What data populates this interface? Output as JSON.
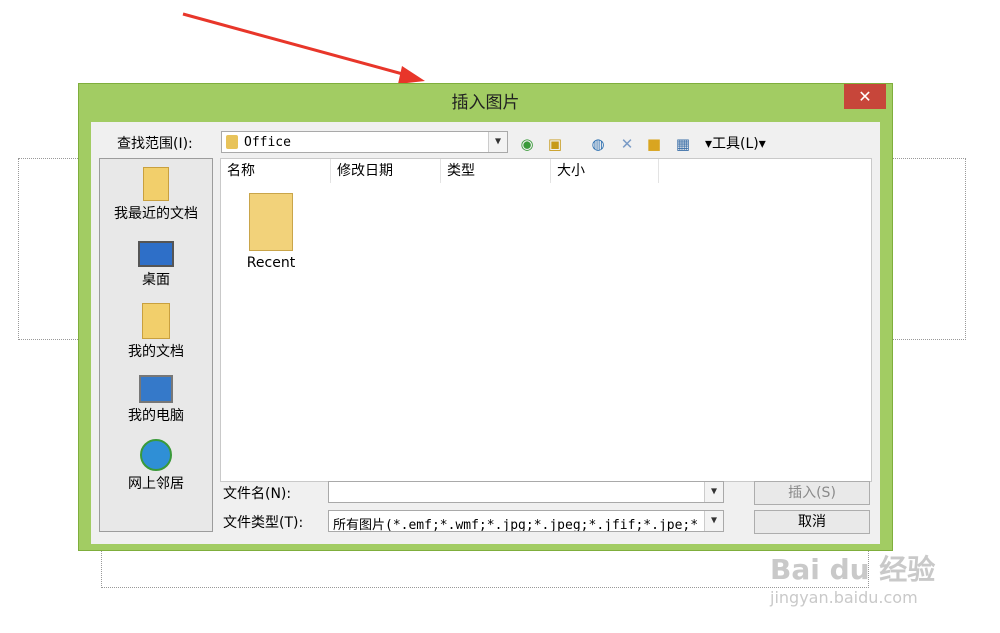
{
  "dialog": {
    "title": "插入图片",
    "close_label": "✕"
  },
  "lookin": {
    "label": "查找范围(I):",
    "value": "Office"
  },
  "toolbar": {
    "tools_label": "▾工具(L)▾"
  },
  "places": [
    {
      "label": "我最近的文档",
      "icon": "recent-folder-icon"
    },
    {
      "label": "桌面",
      "icon": "desktop-icon"
    },
    {
      "label": "我的文档",
      "icon": "my-documents-icon"
    },
    {
      "label": "我的电脑",
      "icon": "my-computer-icon"
    },
    {
      "label": "网上邻居",
      "icon": "network-icon"
    }
  ],
  "columns": [
    "名称",
    "修改日期",
    "类型",
    "大小"
  ],
  "files": [
    {
      "name": "Recent",
      "icon": "folder-icon"
    }
  ],
  "filename": {
    "label": "文件名(N):",
    "value": ""
  },
  "filetype": {
    "label": "文件类型(T):",
    "value": "所有图片(*.emf;*.wmf;*.jpg;*.jpeg;*.jfif;*.jpe;*"
  },
  "buttons": {
    "insert": "插入(S)",
    "cancel": "取消"
  },
  "watermark": {
    "brand": "Bai du 经验",
    "url": "jingyan.baidu.com"
  },
  "colors": {
    "dialog_frame": "#a2cc63",
    "close_button": "#c7463a",
    "annotation_arrow": "#e8362a"
  }
}
